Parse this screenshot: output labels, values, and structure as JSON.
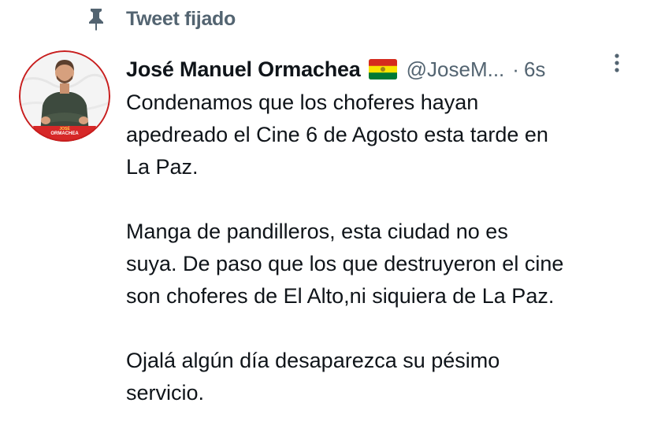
{
  "pinned": {
    "icon": "pin-icon",
    "label": "Tweet fijado"
  },
  "tweet": {
    "author": {
      "name": "José Manuel Ormachea",
      "flag": "bolivia-flag-emoji",
      "handle": "@JoseM...",
      "avatar_banner_text": [
        "JOSÉ",
        "ORMACHEA"
      ],
      "avatar_colors": {
        "ring": "#c81e1e",
        "banner": "#d62828",
        "shirt": "#3d4a3e"
      }
    },
    "separator": "·",
    "time": "6s",
    "body_lines": [
      [
        "Condenamos que los choferes hayan",
        "apedreado el Cine 6 de Agosto esta tarde en",
        "La Paz."
      ],
      [
        "Manga de pandilleros, esta ciudad no es",
        "suya. De paso que los que destruyeron el cine",
        "son choferes de El Alto,ni siquiera de La Paz."
      ],
      [
        "Ojalá algún día desaparezca su pésimo",
        "servicio."
      ]
    ]
  },
  "colors": {
    "text_primary": "#0f1419",
    "text_secondary": "#536471",
    "flag_red": "#d52b1e",
    "flag_yellow": "#f9e300",
    "flag_green": "#007934"
  }
}
